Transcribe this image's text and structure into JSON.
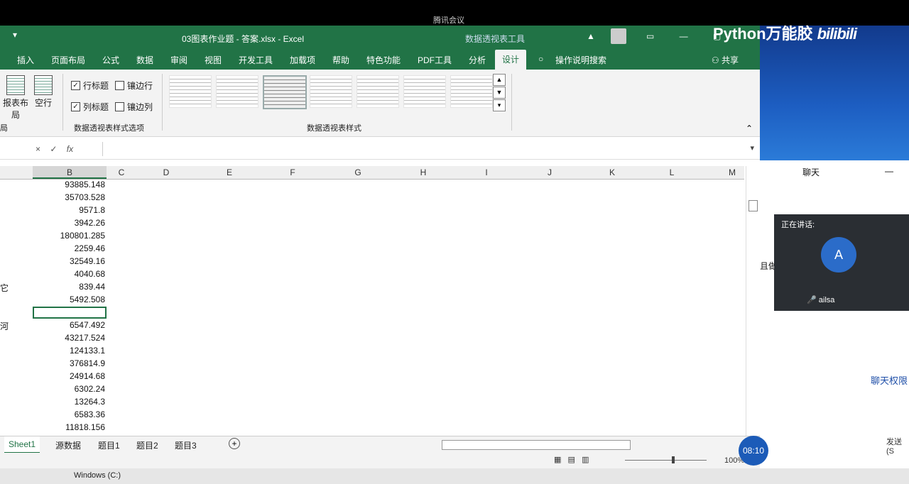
{
  "meeting": {
    "top_label": "腾讯会议",
    "chat_title": "聊天",
    "speaking": "正在讲话:",
    "avatar": "A",
    "name": "ailsa",
    "permission": "聊天权限",
    "send": "发送(S",
    "side_text": "且做"
  },
  "brand": {
    "text": "Python万能胶",
    "logo": "bilibili"
  },
  "excel": {
    "title": "03图表作业题 - 答案.xlsx  -  Excel",
    "context": "数据透视表工具",
    "tabs": [
      "插入",
      "页面布局",
      "公式",
      "数据",
      "审阅",
      "视图",
      "开发工具",
      "加载项",
      "帮助",
      "特色功能",
      "PDF工具",
      "分析",
      "设计"
    ],
    "active_tab": "设计",
    "tell_me": "操作说明搜索",
    "share": "共享",
    "ribbon": {
      "report_layout": "报表布局",
      "blank_rows": "空行",
      "row_headers": "行标题",
      "col_headers": "列标题",
      "banded_rows": "镶边行",
      "banded_cols": "镶边列",
      "group_options": "数据透视表样式选项",
      "group_styles": "数据透视表样式",
      "group_layout": "局"
    },
    "formula": {
      "fx": "fx",
      "cancel": "×",
      "enter": "✓"
    },
    "columns": [
      "B",
      "C",
      "D",
      "E",
      "F",
      "G",
      "H",
      "I",
      "J",
      "K",
      "L",
      "M"
    ],
    "cells": [
      {
        "a": "",
        "b": "93885.148"
      },
      {
        "a": "",
        "b": "35703.528"
      },
      {
        "a": "",
        "b": "9571.8"
      },
      {
        "a": "",
        "b": "3942.26"
      },
      {
        "a": "",
        "b": "180801.285"
      },
      {
        "a": "",
        "b": "2259.46"
      },
      {
        "a": "",
        "b": "32549.16"
      },
      {
        "a": "",
        "b": "4040.68"
      },
      {
        "a": "它",
        "b": "839.44"
      },
      {
        "a": "",
        "b": "5492.508"
      },
      {
        "a": "",
        "b": ""
      },
      {
        "a": "河",
        "b": "6547.492"
      },
      {
        "a": "",
        "b": "43217.524"
      },
      {
        "a": "",
        "b": "124133.1"
      },
      {
        "a": "",
        "b": "376814.9"
      },
      {
        "a": "",
        "b": "24914.68"
      },
      {
        "a": "",
        "b": "6302.24"
      },
      {
        "a": "",
        "b": "13264.3"
      },
      {
        "a": "",
        "b": "6583.36"
      },
      {
        "a": "",
        "b": "11818.156"
      }
    ],
    "sheets": [
      "Sheet1",
      "源数据",
      "题目1",
      "题目2",
      "题目3"
    ],
    "active_sheet": "Sheet1",
    "zoom": "100%"
  },
  "clock": "08:10",
  "taskbar": {
    "label": "Windows (C:)"
  }
}
